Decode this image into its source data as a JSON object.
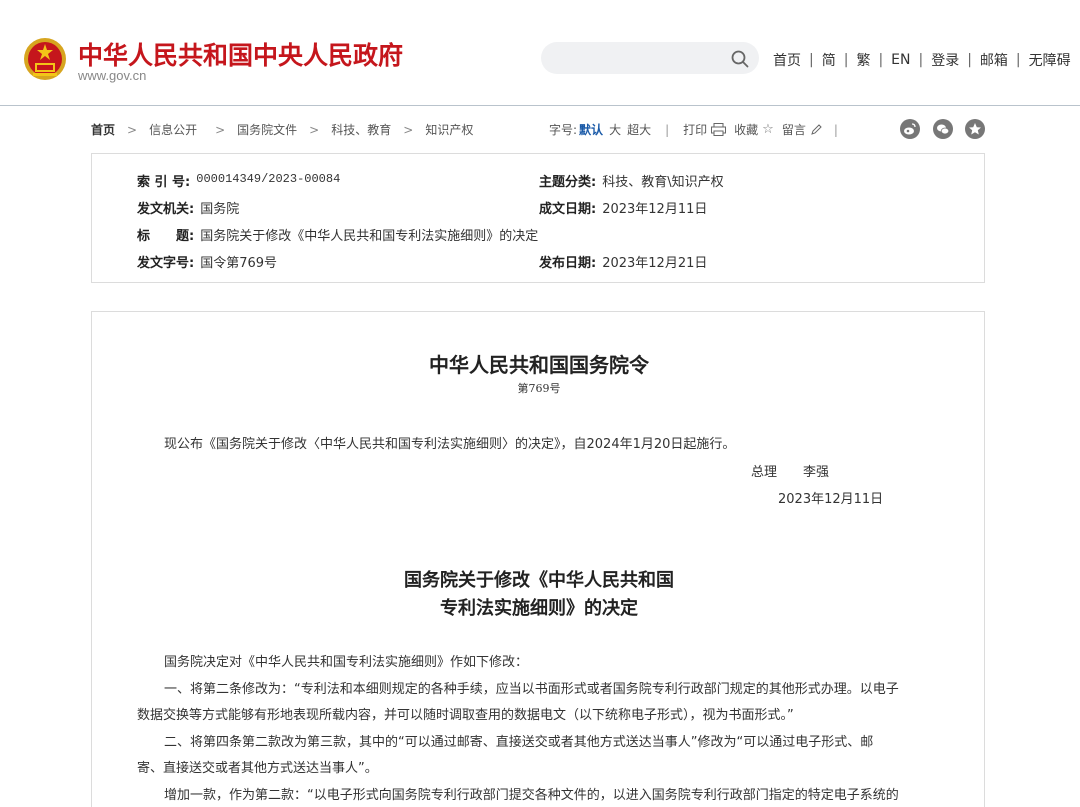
{
  "header": {
    "site_title": "中华人民共和国中央人民政府",
    "site_url": "www.gov.cn",
    "search_placeholder": "",
    "links": [
      "首页",
      "简",
      "繁",
      "EN",
      "登录",
      "邮箱",
      "无障碍"
    ]
  },
  "breadcrumb": [
    "首页",
    "信息公开",
    "国务院文件",
    "科技、教育",
    "知识产权"
  ],
  "tools": {
    "font_label": "字号:",
    "font_sizes": [
      "默认",
      "大",
      "超大"
    ],
    "print": "打印",
    "favorite": "收藏",
    "comment": "留言"
  },
  "meta": {
    "index_label": "索 引 号:",
    "index_value": "000014349/2023-00084",
    "topic_label": "主题分类:",
    "topic_value": "科技、教育\\知识产权",
    "issuer_label": "发文机关:",
    "issuer_value": "国务院",
    "created_label": "成文日期:",
    "created_value": "2023年12月11日",
    "title_label": "标　　题:",
    "title_value": "国务院关于修改《中华人民共和国专利法实施细则》的决定",
    "docno_label": "发文字号:",
    "docno_value": "国令第769号",
    "published_label": "发布日期:",
    "published_value": "2023年12月21日"
  },
  "article": {
    "order_title": "中华人民共和国国务院令",
    "order_no": "第769号",
    "announce": "现公布《国务院关于修改〈中华人民共和国专利法实施细则〉的决定》，自2024年1月20日起施行。",
    "signer": "总理　　李强",
    "sign_date": "2023年12月11日",
    "decision_title_1": "国务院关于修改《中华人民共和国",
    "decision_title_2": "专利法实施细则》的决定",
    "p1": "国务院决定对《中华人民共和国专利法实施细则》作如下修改：",
    "p2a": "一、将第二条修改为：“专利法和本细则规定的各种手续，应当以书面形式或者国务院专利行政部门规定的其他形式办理。以电子",
    "p2b": "数据交换等方式能够有形地表现所载内容，并可以随时调取查用的数据电文（以下统称电子形式），视为书面形式。”",
    "p3a": "二、将第四条第二款改为第三款，其中的“可以通过邮寄、直接送交或者其他方式送达当事人”修改为“可以通过电子形式、邮",
    "p3b": "寄、直接送交或者其他方式送达当事人”。",
    "p4a": "增加一款，作为第二款：“以电子形式向国务院专利行政部门提交各种文件的，以进入国务院专利行政部门指定的特定电子系统的"
  },
  "colors": {
    "brand_red": "#c5161c",
    "link_blue": "#1a5aa8"
  }
}
